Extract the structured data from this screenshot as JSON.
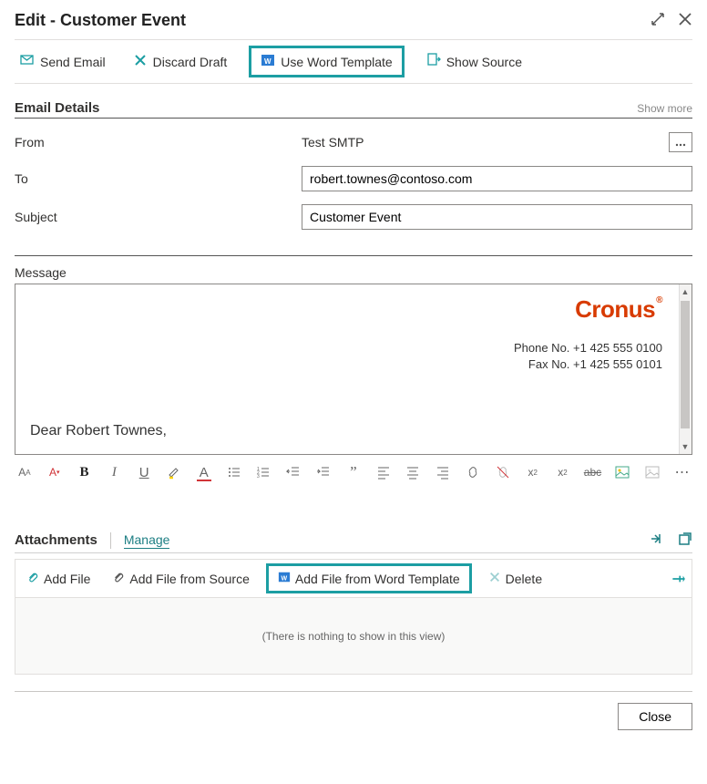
{
  "header": {
    "title": "Edit - Customer Event"
  },
  "toolbar": {
    "send_email": "Send Email",
    "discard_draft": "Discard Draft",
    "use_word_template": "Use Word Template",
    "show_source": "Show Source"
  },
  "email_details": {
    "section_title": "Email Details",
    "show_more": "Show more",
    "from_label": "From",
    "from_value": "Test SMTP",
    "to_label": "To",
    "to_value": "robert.townes@contoso.com",
    "subject_label": "Subject",
    "subject_value": "Customer Event"
  },
  "message": {
    "label": "Message",
    "logo": "Cronus",
    "phone_line": "Phone No. +1 425 555 0100",
    "fax_line": "Fax No. +1 425 555 0101",
    "salutation": "Dear Robert Townes,"
  },
  "attachments": {
    "section_title": "Attachments",
    "manage": "Manage",
    "add_file": "Add File",
    "add_file_from_source": "Add File from Source",
    "add_file_from_word_template": "Add File from Word Template",
    "delete": "Delete",
    "empty_text": "(There is nothing to show in this view)"
  },
  "footer": {
    "close": "Close"
  }
}
